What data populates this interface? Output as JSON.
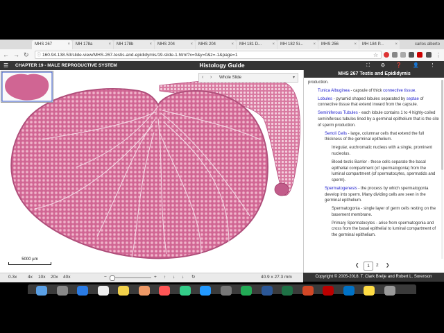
{
  "browser": {
    "tabs": [
      {
        "label": "MHS 267",
        "active": true
      },
      {
        "label": "MH 178a",
        "active": false
      },
      {
        "label": "MH 178b",
        "active": false
      },
      {
        "label": "MHS 204",
        "active": false
      },
      {
        "label": "MHS 204",
        "active": false
      },
      {
        "label": "MH 181 D...",
        "active": false
      },
      {
        "label": "MH 182 Si...",
        "active": false
      },
      {
        "label": "MHS 256",
        "active": false
      },
      {
        "label": "MH 184 P...",
        "active": false
      }
    ],
    "user": "carlos alberto",
    "url": "160.94.138.53/slide-view/MHS-267-testis-and-epididymis/19-slide-1.html?x=0&y=0&z=-1&page=1",
    "nav": {
      "back": "←",
      "forward": "→",
      "reload": "↻",
      "star": "☆"
    }
  },
  "app_header": {
    "menu_icon": "☰",
    "chapter": "CHAPTER 19 - MALE REPRODUCTIVE SYSTEM",
    "title": "Histology Guide",
    "icons": "⛶ ⚙ ❓ 👤 ⋮"
  },
  "viewer": {
    "slide_select": {
      "prev": "‹",
      "next": "›",
      "label": "Whole Slide",
      "caret": "▾"
    },
    "scale_label": "5000 µm"
  },
  "bottom_bar": {
    "zoom": "0.3x",
    "presets": [
      "4x",
      "10x",
      "20x",
      "40x"
    ],
    "minus": "−",
    "plus": "+",
    "arrows": [
      "↑",
      "↓",
      "↓",
      "↻"
    ],
    "dimensions": "40.9 x 27.3 mm"
  },
  "panel": {
    "title": "MHS 267 Testis and Epididymis",
    "intro": "production.",
    "items": [
      {
        "level": 1,
        "bullet": true,
        "term": "Tunica Albuginea",
        "text": " - capsule of thick ",
        "link": "connective tissue",
        "after": "."
      },
      {
        "level": 1,
        "bullet": true,
        "term": "Lobules",
        "text": " - pyramid shaped lobules separated by ",
        "link": "septae",
        "after": " of connective tissue that extend inward from the capsule."
      },
      {
        "level": 1,
        "bullet": true,
        "term": "Seminiferous Tubules",
        "text": " - each lobule contains 1 to 4 highly-coiled seminiferous tubules lined by a germinal epithelium that is the site of sperm production.",
        "link": "",
        "after": ""
      },
      {
        "level": 2,
        "bullet": true,
        "term": "Sertoli Cells",
        "text": " - large, columnar cells that extend the full thickness of the germinal epithelium.",
        "link": "",
        "after": ""
      },
      {
        "level": 3,
        "bullet": true,
        "term": "",
        "text": "Irregular, euchromatic nucleus with a single, prominent nucleolus.",
        "link": "",
        "after": ""
      },
      {
        "level": 3,
        "bullet": true,
        "term": "",
        "text": "Blood-testis Barrier - these cells separate the basal epithelial compartment (of spermatogonia) from the luminal compartment (of spermatocytes, spermatids and sperm).",
        "link": "",
        "after": ""
      },
      {
        "level": 2,
        "bullet": true,
        "term": "Spermatogenesis",
        "text": " - the process by which spermatogonia develop into sperm. Many dividing cells are seen in the germinal epithelium.",
        "link": "",
        "after": ""
      },
      {
        "level": 3,
        "bullet": true,
        "term": "",
        "text": "Spermatogonia - single layer of germ cells resting on the basement membrane.",
        "link": "",
        "after": ""
      },
      {
        "level": 3,
        "bullet": true,
        "term": "",
        "text": "Primary Spermatocytes - arise from spermatogonia and cross from the basal epithelial to luminal compartment of the germinal epithelium.",
        "link": "",
        "after": ""
      }
    ],
    "pager": {
      "prev": "❮",
      "current": "1",
      "next_page": "2",
      "next": "❯"
    }
  },
  "copyright": "Copyright © 2005-2018. T. Clark Brelje and Robert L. Sorenson",
  "dock_apps": [
    "finder",
    "launchpad",
    "safari",
    "calendar",
    "notes",
    "photos",
    "music",
    "chrome",
    "appstore",
    "settings",
    "xcode",
    "word",
    "excel",
    "powerpoint",
    "acrobat",
    "outlook",
    "stickies",
    "trash"
  ],
  "colors": {
    "header_bg": "#353535",
    "tissue": "#d7709b",
    "link": "#1a1acc"
  }
}
